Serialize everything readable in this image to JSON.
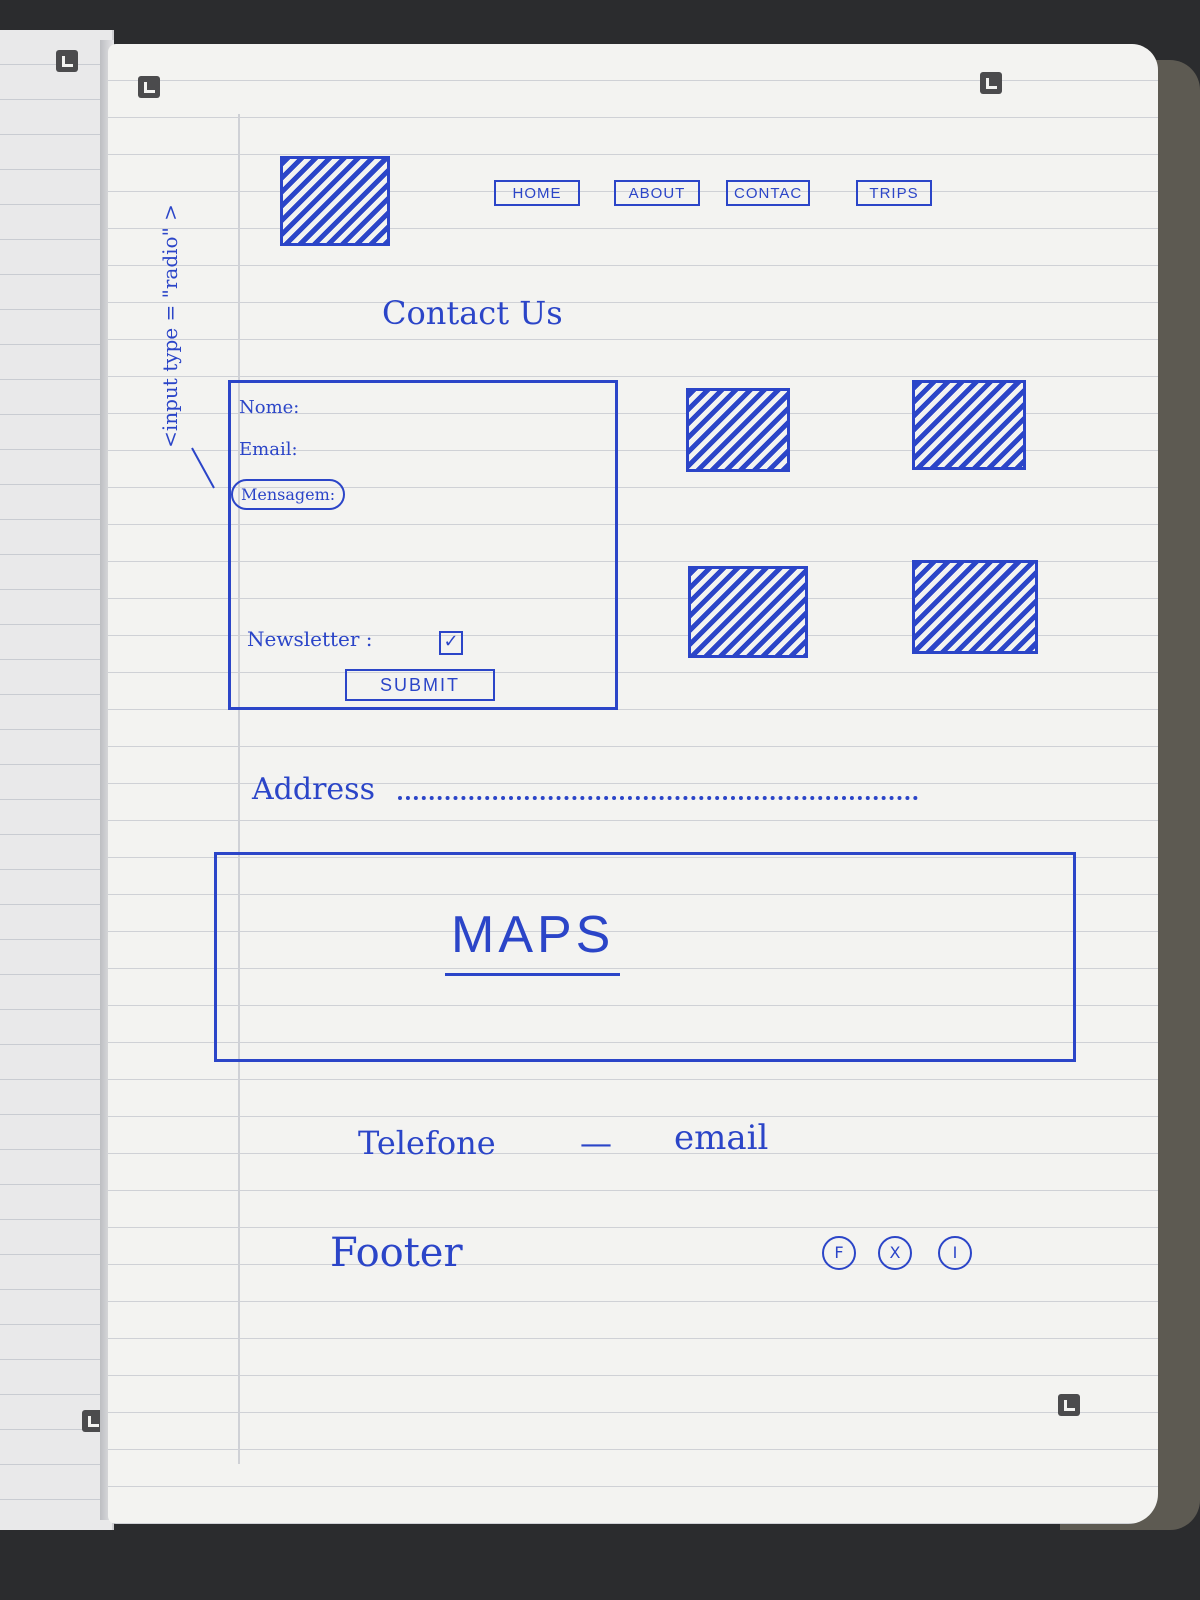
{
  "annotation": "<input type = \"radio\" >",
  "nav": {
    "items": [
      "HOME",
      "ABOUT",
      "CONTAC",
      "TRIPS"
    ]
  },
  "page_title": "Contact Us",
  "form": {
    "name_label": "Nome:",
    "email_label": "Email:",
    "message_label": "Mensagem:",
    "newsletter_label": "Newsletter :",
    "newsletter_checked": true,
    "submit_label": "SUBMIT"
  },
  "address_label": "Address",
  "map": {
    "label": "MAPS"
  },
  "contact": {
    "phone_label": "Telefone",
    "separator": "—",
    "email_label": "email"
  },
  "footer": {
    "label": "Footer",
    "social_icons": [
      "F",
      "X",
      "I"
    ]
  },
  "colors": {
    "ink": "#2b45c8",
    "paper": "#f3f3f1",
    "rule": "#cfd1d6"
  }
}
